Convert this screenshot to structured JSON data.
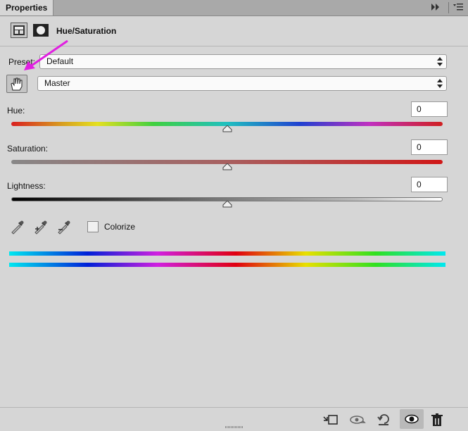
{
  "panel": {
    "tab_title": "Properties",
    "adjustment_title": "Hue/Saturation",
    "icons": [
      "adjustment-layer-icon",
      "layer-mask-icon",
      "collapse-icon",
      "panel-menu-icon"
    ]
  },
  "preset": {
    "label": "Preset:",
    "value": "Default"
  },
  "channel": {
    "value": "Master"
  },
  "hue": {
    "label": "Hue:",
    "value": "0",
    "slider_fraction": 0.5
  },
  "saturation": {
    "label": "Saturation:",
    "value": "0",
    "slider_fraction": 0.5
  },
  "lightness": {
    "label": "Lightness:",
    "value": "0",
    "slider_fraction": 0.5
  },
  "colorize": {
    "label": "Colorize",
    "checked": false
  },
  "annotation_arrow_color": "#e020e0",
  "footer_icons": [
    "clip-to-layer-icon",
    "view-previous-state-icon",
    "reset-icon",
    "visibility-eye-icon",
    "delete-icon"
  ]
}
